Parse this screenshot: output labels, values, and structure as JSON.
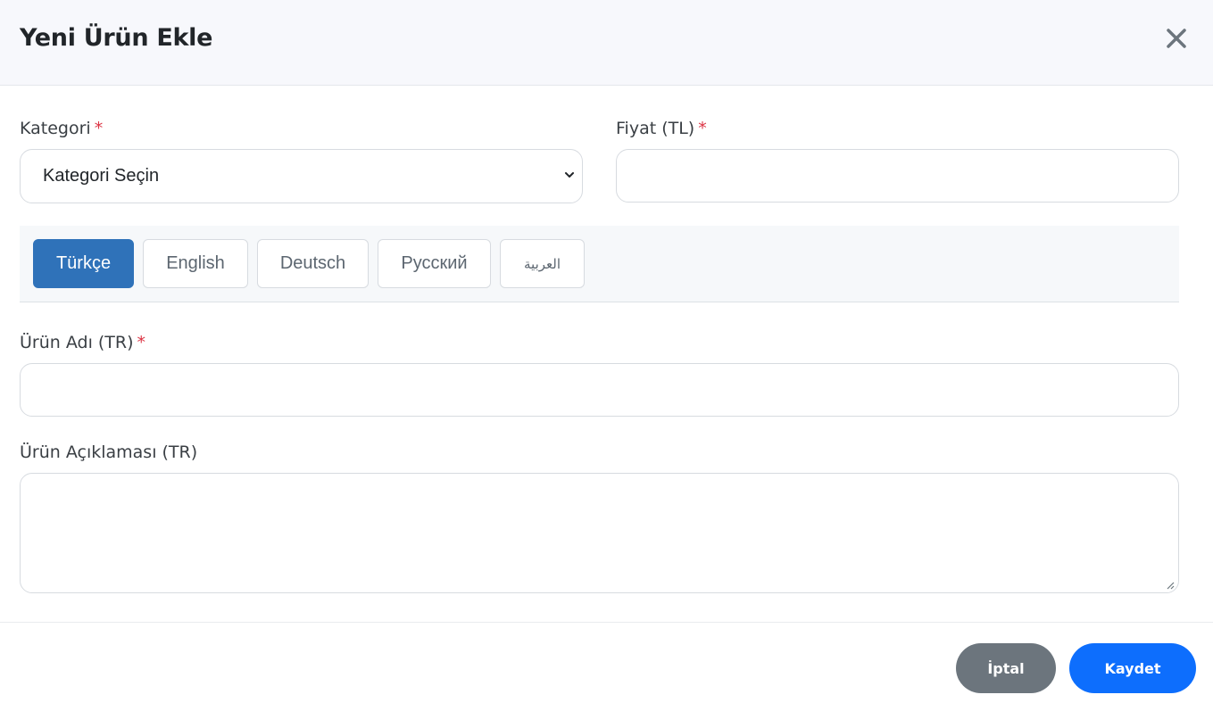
{
  "modal": {
    "title": "Yeni Ürün Ekle",
    "close_icon": "close-icon"
  },
  "form": {
    "category": {
      "label": "Kategori",
      "required_mark": "*",
      "selected": "Kategori Seçin"
    },
    "price": {
      "label": "Fiyat (TL)",
      "required_mark": "*",
      "value": ""
    },
    "language_tabs": [
      {
        "label": "Türkçe",
        "active": true
      },
      {
        "label": "English",
        "active": false
      },
      {
        "label": "Deutsch",
        "active": false
      },
      {
        "label": "Русский",
        "active": false
      },
      {
        "label": "العربية",
        "active": false
      }
    ],
    "product_name": {
      "label": "Ürün Adı (TR)",
      "required_mark": "*",
      "value": ""
    },
    "product_description": {
      "label": "Ürün Açıklaması (TR)",
      "value": ""
    }
  },
  "footer": {
    "cancel_label": "İptal",
    "save_label": "Kaydet"
  },
  "colors": {
    "primary": "#0d6efd",
    "active_tab": "#2f72b9",
    "secondary": "#6c757d",
    "required": "#dc3545",
    "header_bg": "#f7f8fc"
  }
}
